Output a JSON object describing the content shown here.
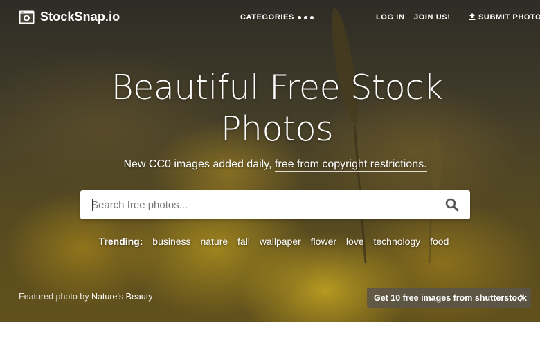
{
  "brand": {
    "name": "StockSnap.io",
    "logo_icon": "camera-icon"
  },
  "nav": {
    "categories": "CATEGORIES",
    "more_icon": "more-dots-icon",
    "login": "LOG IN",
    "join": "JOIN US!",
    "submit": "SUBMIT PHOTOS",
    "submit_icon": "upload-icon"
  },
  "hero": {
    "title": "Beautiful Free Stock Photos",
    "subtitle_prefix": "New CC0 images added daily, ",
    "subtitle_link": "free from copyright restrictions."
  },
  "search": {
    "placeholder": "Search free photos...",
    "value": "",
    "icon": "search-icon"
  },
  "trending": {
    "label": "Trending:",
    "tags": [
      "business",
      "nature",
      "fall",
      "wallpaper",
      "flower",
      "love",
      "technology",
      "food"
    ]
  },
  "footer": {
    "featured_prefix": "Featured photo by ",
    "featured_author": "Nature's Beauty",
    "promo_label": "Get 10 free images from shutterstock",
    "promo_icon": "chevron-right-icon"
  },
  "colors": {
    "hero_gold": "#d9b227",
    "hero_dark": "#3e3b33",
    "promo_bg": "#5a554b",
    "text": "#ffffff"
  }
}
